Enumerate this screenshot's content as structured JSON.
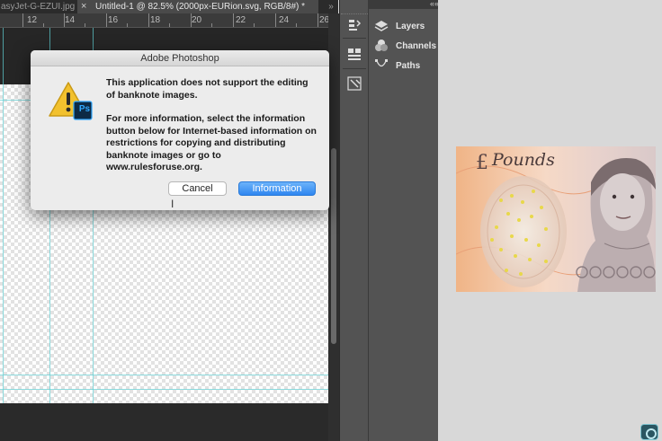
{
  "tabs": [
    {
      "label": "asyJet-G-EZUI.jpg",
      "active": false
    },
    {
      "label": "Untitled-1 @ 82.5% (2000px-EURion.svg, RGB/8#) *",
      "active": true,
      "close_glyph": "×"
    }
  ],
  "tabs_overflow": "»",
  "ruler": {
    "numbers": [
      "12",
      "14",
      "16",
      "18",
      "20",
      "22",
      "24",
      "26"
    ]
  },
  "dialog": {
    "title": "Adobe Photoshop",
    "message_line1": "This application does not support the editing of banknote images.",
    "message_line2": "For more information, select the information button below for Internet-based information on restrictions for copying and distributing banknote images or go to www.rulesforuse.org.",
    "cancel_label": "Cancel",
    "info_label": "Information",
    "icon": "warning-icon",
    "badge_text": "Ps"
  },
  "panel_collapse_left": "««",
  "panel_collapse_right": "««",
  "panels": [
    {
      "label": "Layers",
      "icon": "layers-icon"
    },
    {
      "label": "Channels",
      "icon": "channels-icon"
    },
    {
      "label": "Paths",
      "icon": "paths-icon"
    }
  ],
  "banknote": {
    "script_text": "Pounds",
    "symbol": "£"
  },
  "colors": {
    "accent_button": "#2f86f0",
    "guide": "#5fd0d4",
    "panel_bg": "#535353",
    "warning": "#f2c12e"
  }
}
